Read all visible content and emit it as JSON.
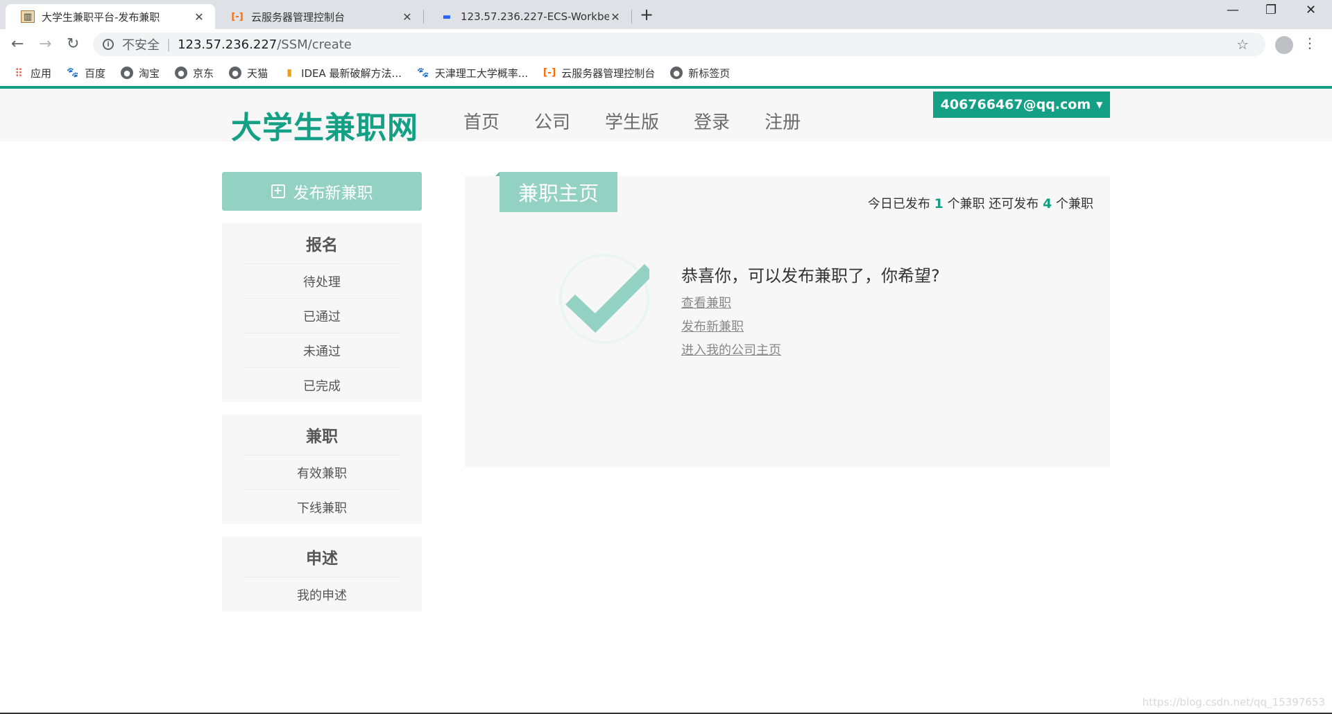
{
  "browser": {
    "tabs": [
      {
        "title": "大学生兼职平台-发布兼职",
        "close": "✕"
      },
      {
        "title": "云服务器管理控制台",
        "close": "✕"
      },
      {
        "title": "123.57.236.227-ECS-Workbench",
        "close": "✕"
      }
    ],
    "new_tab": "+",
    "window": {
      "minimize": "—",
      "restore": "❐",
      "close": "✕"
    },
    "nav": {
      "back": "←",
      "forward": "→",
      "reload": "↻"
    },
    "address": {
      "security": "不安全",
      "host": "123.57.236.227",
      "path": "/SSM/create"
    },
    "bookmarks": [
      "应用",
      "百度",
      "淘宝",
      "京东",
      "天猫",
      "IDEA 最新破解方法...",
      "天津理工大学概率...",
      "云服务器管理控制台",
      "新标签页"
    ]
  },
  "site": {
    "logo": "大学生兼职网",
    "nav": [
      "首页",
      "公司",
      "学生版",
      "登录",
      "注册"
    ],
    "user": "406766467@qq.com"
  },
  "sidebar": {
    "publish": "发布新兼职",
    "groups": [
      {
        "title": "报名",
        "items": [
          "待处理",
          "已通过",
          "未通过",
          "已完成"
        ]
      },
      {
        "title": "兼职",
        "items": [
          "有效兼职",
          "下线兼职"
        ]
      },
      {
        "title": "申述",
        "items": [
          "我的申述"
        ]
      }
    ]
  },
  "main": {
    "ribbon": "兼职主页",
    "quota": {
      "prefix": "今日已发布",
      "published": "1",
      "mid": "个兼职 还可发布",
      "remaining": "4",
      "suffix": "个兼职"
    },
    "message": "恭喜你，可以发布兼职了，你希望?",
    "links": [
      "查看兼职",
      "发布新兼职",
      "进入我的公司主页"
    ]
  },
  "watermark": "https://blog.csdn.net/qq_15397653",
  "colors": {
    "brand": "#14a085",
    "accent_light": "#93d1c3"
  }
}
